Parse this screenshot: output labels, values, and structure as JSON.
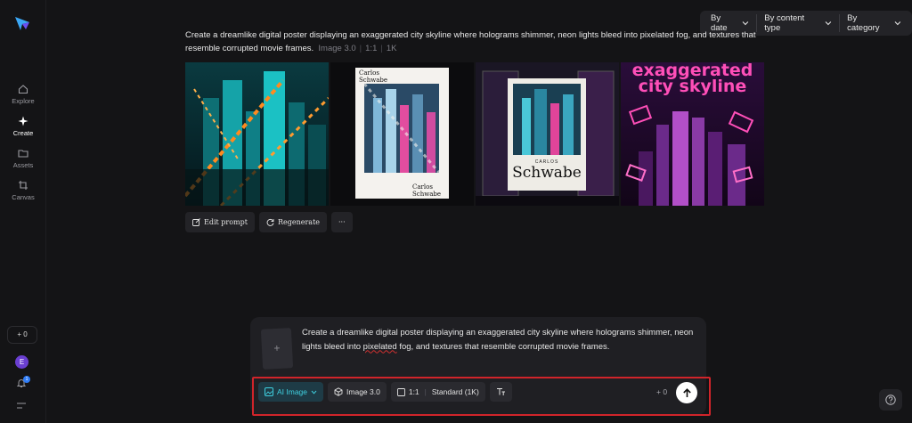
{
  "sidebar": {
    "items": [
      {
        "label": "Explore",
        "icon": "home-icon"
      },
      {
        "label": "Create",
        "icon": "sparkle-icon"
      },
      {
        "label": "Assets",
        "icon": "folder-icon"
      },
      {
        "label": "Canvas",
        "icon": "crop-icon"
      }
    ],
    "credits": "+ 0",
    "avatar_initial": "E",
    "notification_count": "1"
  },
  "filters": {
    "by_date": "By date",
    "by_content_type": "By content type",
    "by_category": "By category"
  },
  "generation": {
    "prompt": "Create a dreamlike digital poster displaying an exaggerated city skyline where holograms shimmer, neon lights bleed into pixelated fog, and textures that resemble corrupted movie frames.",
    "model": "Image 3.0",
    "ratio": "1:1",
    "resolution": "1K",
    "images": [
      {
        "caption": ""
      },
      {
        "caption": "Carlos Schwabe",
        "caption_bottom": "Carlos Schwabe"
      },
      {
        "caption_top": "CARLOS",
        "caption": "Schwabe"
      },
      {
        "caption": "exaggerated city skyline"
      }
    ],
    "actions": {
      "edit_prompt": "Edit prompt",
      "regenerate": "Regenerate",
      "more": "···"
    }
  },
  "composer": {
    "upload_symbol": "+",
    "text_before": "Create a dreamlike digital poster displaying an exaggerated city skyline where holograms shimmer, neon lights bleed into ",
    "text_flagged": "pixelated",
    "text_after": " fog, and textures that resemble corrupted movie frames.",
    "mode": "AI Image",
    "model": "Image 3.0",
    "ratio": "1:1",
    "quality": "Standard (1K)",
    "credit_cost": "+ 0",
    "accent_color": "#3fd0e0",
    "highlight_color": "#d0242a"
  }
}
